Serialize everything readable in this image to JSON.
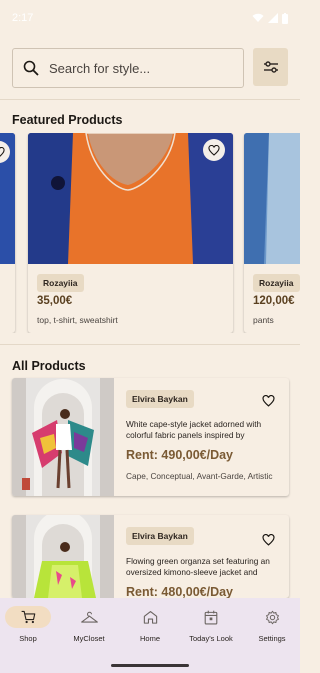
{
  "status_bar": {
    "time": "2:17"
  },
  "search": {
    "placeholder": "Search for style..."
  },
  "featured": {
    "title": "Featured Products",
    "items": [
      {
        "brand": "Rozayiia",
        "price": "35,00€",
        "tags": "top, t-shirt, sweatshirt"
      },
      {
        "brand": "Rozayiia",
        "price": "120,00€",
        "tags": "pants"
      }
    ]
  },
  "all_products": {
    "title": "All Products",
    "items": [
      {
        "brand": "Elvira Baykan",
        "description": "White cape-style jacket adorned with colorful fabric panels inspired by",
        "rent": "Rent: 490,00€/Day",
        "tags": "Cape, Conceptual, Avant-Garde, Artistic"
      },
      {
        "brand": "Elvira Baykan",
        "description": "Flowing green organza set featuring an oversized kimono-sleeve jacket and",
        "rent": "Rent: 480,00€/Day",
        "tags": ""
      }
    ]
  },
  "nav": {
    "items": [
      {
        "label": "Shop",
        "icon": "cart-icon",
        "active": true
      },
      {
        "label": "MyCloset",
        "icon": "hanger-icon",
        "active": false
      },
      {
        "label": "Home",
        "icon": "home-icon",
        "active": false
      },
      {
        "label": "Today's Look",
        "icon": "calendar-icon",
        "active": false
      },
      {
        "label": "Settings",
        "icon": "gear-icon",
        "active": false
      }
    ]
  },
  "colors": {
    "background": "#F7EEE3",
    "chip": "#E8DAC4",
    "nav_background": "#EDE4EF",
    "price_brown": "#7a5a34"
  }
}
